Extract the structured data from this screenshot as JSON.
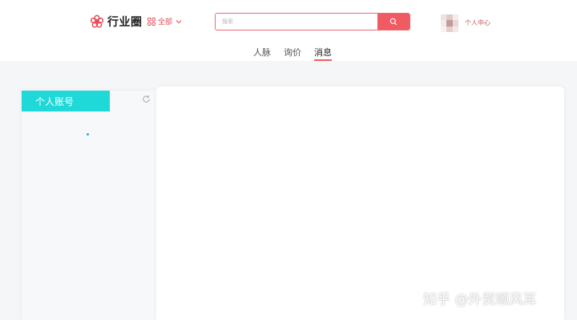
{
  "header": {
    "logo_icon": "flower-icon",
    "logo_text": "行业圈",
    "category": {
      "icon": "grid-icon",
      "label": "全部",
      "chevron": "chevron-down-icon"
    },
    "search": {
      "placeholder": "搜索",
      "button_icon": "search-icon"
    },
    "user": {
      "avatar": "avatar",
      "label": "个人中心"
    }
  },
  "tabs": [
    {
      "label": "人脉",
      "active": false
    },
    {
      "label": "询价",
      "active": false
    },
    {
      "label": "消息",
      "active": true
    }
  ],
  "sidebar": {
    "account_tab": "个人账号",
    "refresh_icon": "refresh-icon"
  },
  "watermark": "知乎 @外贸顺风耳",
  "colors": {
    "accent_red": "#ef5a63",
    "accent_cyan": "#1fd8d8",
    "page_bg": "#f5f6f8"
  }
}
